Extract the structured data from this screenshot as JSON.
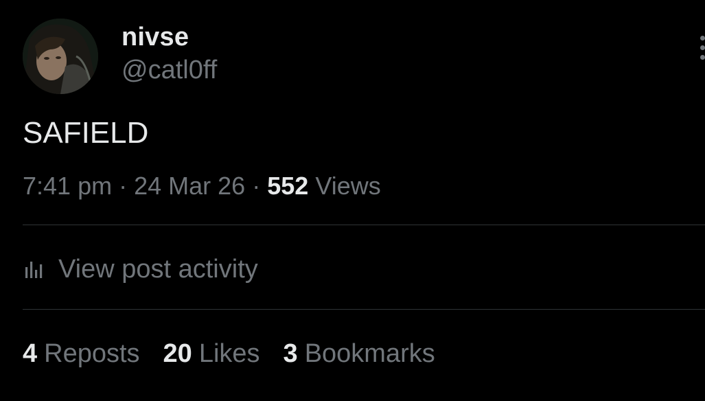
{
  "author": {
    "display_name": "nivse",
    "handle": "@catl0ff",
    "avatar_icon": "user-avatar"
  },
  "post": {
    "text": "SAFIELD",
    "time": "7:41 pm",
    "separator": "·",
    "date": "24 Mar 26",
    "views_count": "552",
    "views_label": "Views"
  },
  "activity": {
    "icon": "analytics-bars-icon",
    "label": "View post activity"
  },
  "stats": {
    "reposts_count": "4",
    "reposts_label": "Reposts",
    "likes_count": "20",
    "likes_label": "Likes",
    "bookmarks_count": "3",
    "bookmarks_label": "Bookmarks"
  },
  "colors": {
    "background": "#000000",
    "primary_text": "#e7e9ea",
    "secondary_text": "#71767b",
    "divider": "#2f3336"
  }
}
